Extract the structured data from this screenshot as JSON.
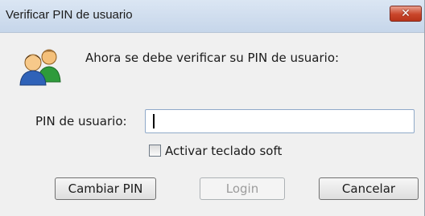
{
  "window": {
    "title": "Verificar PIN de usuario"
  },
  "dialog": {
    "prompt": "Ahora se debe verificar su PIN de usuario:",
    "pin_label": "PIN de usuario:",
    "pin_value": "",
    "soft_keyboard_label": "Activar teclado soft",
    "soft_keyboard_checked": false
  },
  "buttons": {
    "change_pin": "Cambiar PIN",
    "login": "Login",
    "cancel": "Cancelar"
  },
  "icons": {
    "close": "close-icon",
    "users": "users-icon",
    "close_symbol": "✕"
  },
  "colors": {
    "close_button": "#c9452a",
    "title_bar": "#c6d6ea",
    "input_border": "#8fa9c9"
  }
}
